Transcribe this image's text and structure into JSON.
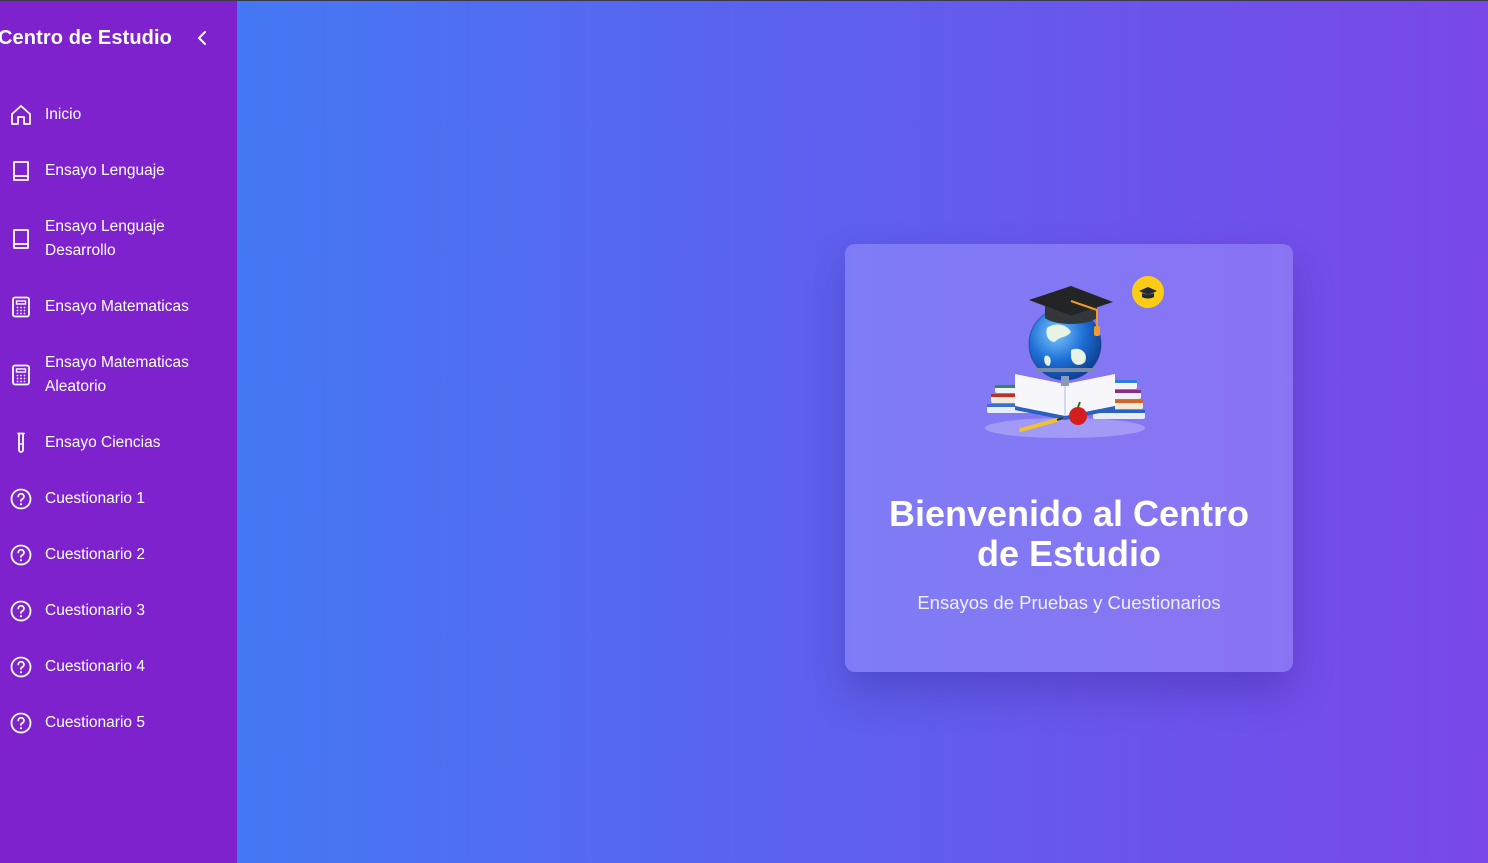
{
  "sidebar": {
    "title": "Centro de Estudio",
    "collapse_icon": "chevron-left-icon",
    "items": [
      {
        "label": "Inicio",
        "icon": "home-icon"
      },
      {
        "label": "Ensayo Lenguaje",
        "icon": "book-icon"
      },
      {
        "label_line1": "Ensayo Lenguaje",
        "label_line2": "Desarrollo",
        "icon": "book-icon"
      },
      {
        "label": "Ensayo Matematicas",
        "icon": "calculator-icon"
      },
      {
        "label_line1": "Ensayo Matematicas",
        "label_line2": "Aleatorio",
        "icon": "calculator-icon"
      },
      {
        "label": "Ensayo Ciencias",
        "icon": "test-tube-icon"
      },
      {
        "label": "Cuestionario 1",
        "icon": "help-circle-icon"
      },
      {
        "label": "Cuestionario 2",
        "icon": "help-circle-icon"
      },
      {
        "label": "Cuestionario 3",
        "icon": "help-circle-icon"
      },
      {
        "label": "Cuestionario 4",
        "icon": "help-circle-icon"
      },
      {
        "label": "Cuestionario 5",
        "icon": "help-circle-icon"
      }
    ]
  },
  "welcome": {
    "title_line1": "Bienvenido al Centro",
    "title_line2": "de Estudio",
    "subtitle": "Ensayos de Pruebas y Cuestionarios",
    "illustration": "globe-books-graduation-cap-illustration",
    "badge_icon": "graduation-cap-icon"
  },
  "colors": {
    "sidebar_bg": "#7e22ce",
    "gradient_start": "#3b82f6",
    "gradient_end": "#7a48e8",
    "badge": "#facc15"
  }
}
